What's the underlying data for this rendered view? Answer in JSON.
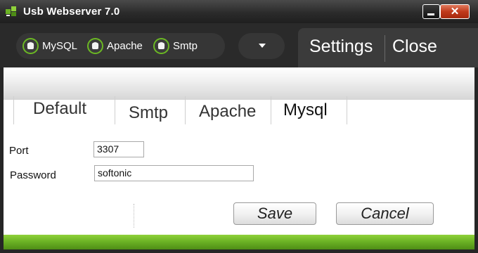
{
  "window": {
    "title": "Usb Webserver 7.0",
    "close_symbol": "✕"
  },
  "toolbar": {
    "servers": [
      {
        "label": "MySQL"
      },
      {
        "label": "Apache"
      },
      {
        "label": "Smtp"
      }
    ],
    "menu": {
      "settings": "Settings",
      "close": "Close"
    }
  },
  "tabs": [
    {
      "label": "Default"
    },
    {
      "label": "Smtp"
    },
    {
      "label": "Apache"
    },
    {
      "label": "Mysql",
      "active": true
    }
  ],
  "form": {
    "port_label": "Port",
    "port_value": "3307",
    "password_label": "Password",
    "password_value": "softonic"
  },
  "buttons": {
    "save": "Save",
    "cancel": "Cancel"
  },
  "colors": {
    "accent_green": "#6cb325",
    "close_red": "#c0391b"
  }
}
